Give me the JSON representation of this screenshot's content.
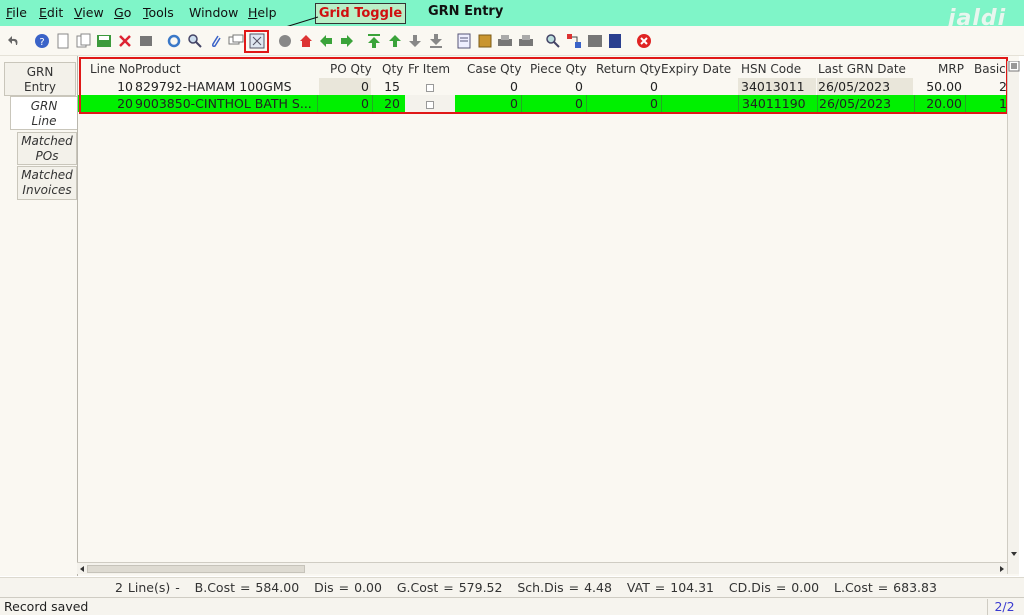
{
  "menu": {
    "items": [
      {
        "label": "File",
        "u": "F",
        "rest": "ile"
      },
      {
        "label": "Edit",
        "u": "E",
        "rest": "dit"
      },
      {
        "label": "View",
        "u": "V",
        "rest": "iew"
      },
      {
        "label": "Go",
        "u": "G",
        "rest": "o"
      },
      {
        "label": "Tools",
        "u": "T",
        "rest": "ools"
      },
      {
        "label": "Window",
        "u": "",
        "rest": "Window"
      },
      {
        "label": "Help",
        "u": "H",
        "rest": "elp"
      }
    ]
  },
  "window_title": "GRN Entry",
  "brand": "jaldi",
  "callout": "Grid Toggle",
  "toolbar_icons": [
    "undo-icon",
    "help-icon",
    "new-icon",
    "copy-icon",
    "save-icon",
    "delete-icon",
    "print-icon",
    "refresh-icon",
    "find-icon",
    "attach-icon",
    "chat-icon",
    "grid-toggle-icon",
    "history-icon",
    "home-icon",
    "back-icon",
    "forward-icon",
    "first-icon",
    "up-icon",
    "down-icon",
    "last-icon",
    "report-icon",
    "archive-icon",
    "print2-icon",
    "print3-icon",
    "zoom-icon",
    "workflow-icon",
    "request-icon",
    "product-icon",
    "close-icon"
  ],
  "sidebar": {
    "tabs": [
      {
        "line1": "GRN",
        "line2": "Entry"
      },
      {
        "line1": "GRN",
        "line2": "Line"
      },
      {
        "line1": "Matched",
        "line2": "POs"
      },
      {
        "line1": "Matched",
        "line2": "Invoices"
      }
    ]
  },
  "grid": {
    "columns": [
      "Line No",
      "Product",
      "PO Qty",
      "Qty",
      "Fr Item",
      "Case Qty",
      "Piece Qty",
      "Return Qty",
      "Expiry Date",
      "HSN Code",
      "Last GRN Date",
      "MRP",
      "Basic"
    ],
    "rows": [
      {
        "line_no": "10",
        "product": "829792-HAMAM 100GMS",
        "po_qty": "0",
        "qty": "15",
        "case_qty": "0",
        "piece_qty": "0",
        "return_qty": "0",
        "expiry": "",
        "hsn": "34013011",
        "last_grn": "26/05/2023",
        "mrp": "50.00",
        "basic": "2"
      },
      {
        "line_no": "20",
        "product": "9003850-CINTHOL BATH S...",
        "po_qty": "0",
        "qty": "20",
        "case_qty": "0",
        "piece_qty": "0",
        "return_qty": "0",
        "expiry": "",
        "hsn": "34011190",
        "last_grn": "26/05/2023",
        "mrp": "20.00",
        "basic": "1"
      }
    ]
  },
  "summary": "2 Line(s) -   B.Cost = 584.00   Dis = 0.00   G.Cost = 579.52   Sch.Dis = 4.48   VAT = 104.31   CD.Dis = 0.00   L.Cost = 683.83",
  "status": "Record saved",
  "page_indicator": "2/2",
  "colors": {
    "menubar": "#7ff5c8",
    "selected_row": "#00f000",
    "highlight": "#e01818"
  }
}
